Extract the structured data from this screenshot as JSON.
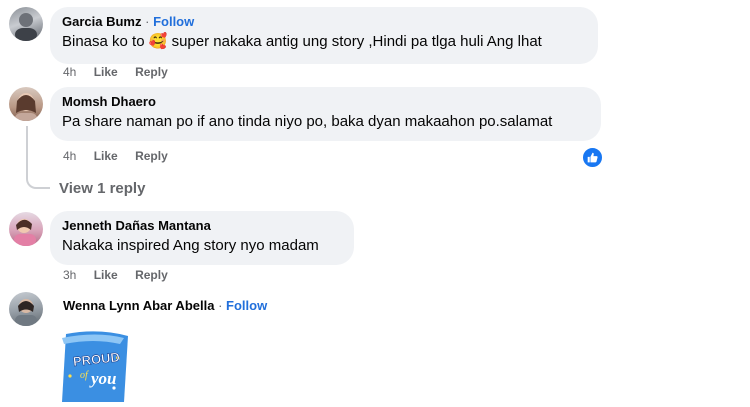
{
  "comments": [
    {
      "author": "Garcia Bumz",
      "follow": "Follow",
      "text_before": "Binasa ko to",
      "emoji": "🥰",
      "text_after": " super nakaka antig ung story ,Hindi pa tlga huli Ang lhat",
      "time": "4h",
      "like": "Like",
      "reply": "Reply"
    },
    {
      "author": "Momsh Dhaero",
      "text": "Pa share naman po if ano tinda niyo po, baka dyan makaahon po.salamat",
      "time": "4h",
      "like": "Like",
      "reply": "Reply",
      "reaction_icon": "thumbs-up-icon",
      "view_replies": "View 1 reply"
    },
    {
      "author": "Jenneth Dañas Mantana",
      "text": "Nakaka inspired Ang story nyo madam",
      "time": "3h",
      "like": "Like",
      "reply": "Reply"
    },
    {
      "author": "Wenna Lynn Abar Abella",
      "follow": "Follow",
      "sticker_text_top": "PROUD",
      "sticker_text_mid": "of",
      "sticker_text_bottom": "you"
    }
  ],
  "separator": "·",
  "colors": {
    "accent": "#216fdb",
    "bubble": "#f0f2f5",
    "meta": "#65676b",
    "like_badge": "#1877f2"
  }
}
